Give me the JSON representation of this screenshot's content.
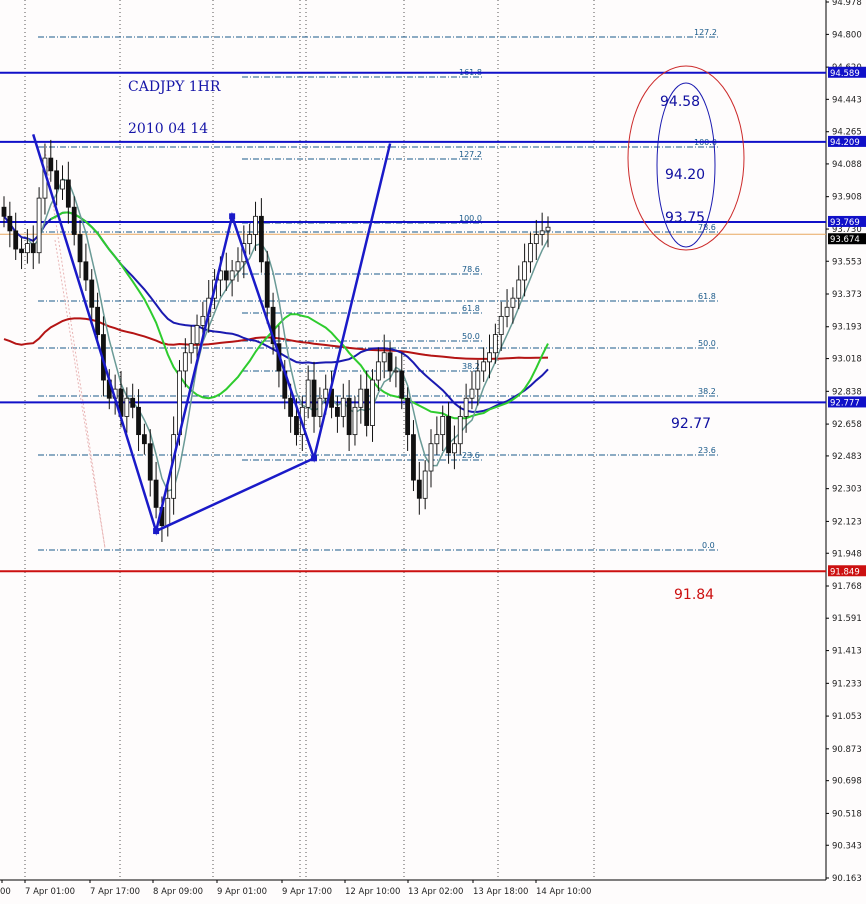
{
  "chart_data": {
    "type": "candlestick",
    "title_lines": [
      "CADJPY 1HR",
      "2010 04 14"
    ],
    "symbol": "CADJPY",
    "timeframe": "1HR",
    "date": "2010 04 14",
    "ylim": [
      90.163,
      94.978
    ],
    "y_ticks": [
      "94.978",
      "94.800",
      "94.620",
      "94.443",
      "94.265",
      "94.088",
      "93.908",
      "93.730",
      "93.553",
      "93.373",
      "93.193",
      "93.018",
      "92.838",
      "92.658",
      "92.483",
      "92.303",
      "92.123",
      "91.948",
      "91.768",
      "91.591",
      "91.413",
      "91.233",
      "91.053",
      "90.873",
      "90.698",
      "90.518",
      "90.343",
      "90.163"
    ],
    "x_ticks": [
      "00",
      "7 Apr 01:00",
      "7 Apr 17:00",
      "8 Apr 09:00",
      "9 Apr 01:00",
      "9 Apr 17:00",
      "12 Apr 10:00",
      "13 Apr 02:00",
      "13 Apr 18:00",
      "14 Apr 10:00"
    ],
    "horizontal_lines": [
      {
        "price": 94.589,
        "label": "94.589",
        "color": "#1010c8"
      },
      {
        "price": 94.209,
        "label": "94.209",
        "color": "#1010c8"
      },
      {
        "price": 93.769,
        "label": "93.769",
        "color": "#1010c8"
      },
      {
        "price": 92.777,
        "label": "92.777",
        "color": "#1010c8"
      },
      {
        "price": 91.849,
        "label": "91.849",
        "color": "#cc1010"
      }
    ],
    "current_price": {
      "price": 93.674,
      "label": "93.674"
    },
    "annotations": [
      {
        "text": "94.58",
        "color": "#1010a0"
      },
      {
        "text": "94.20",
        "color": "#1010a0"
      },
      {
        "text": "93.75",
        "color": "#1010a0"
      },
      {
        "text": "92.77",
        "color": "#1010a0"
      },
      {
        "text": "91.84",
        "color": "#cc1010"
      }
    ],
    "fib_upper_labels": [
      "127.2",
      "161.8",
      "100.0",
      "127.2",
      "100.0",
      "78.6",
      "61.8",
      "50.0",
      "38.2",
      "23.6"
    ],
    "fib_lower_labels": [
      "78.6",
      "61.8",
      "50.0",
      "38.2",
      "23.6",
      "0.0"
    ],
    "closes": [
      93.8,
      93.72,
      93.62,
      93.6,
      93.65,
      93.6,
      93.9,
      94.12,
      94.05,
      93.95,
      94.0,
      93.85,
      93.7,
      93.55,
      93.45,
      93.3,
      93.15,
      92.9,
      92.8,
      92.85,
      92.7,
      92.8,
      92.75,
      92.6,
      92.55,
      92.35,
      92.2,
      92.1,
      92.25,
      92.6,
      92.95,
      93.05,
      93.1,
      93.2,
      93.25,
      93.35,
      93.45,
      93.5,
      93.45,
      93.5,
      93.55,
      93.65,
      93.7,
      93.8,
      93.55,
      93.3,
      93.1,
      92.95,
      92.8,
      92.7,
      92.6,
      92.75,
      92.9,
      92.7,
      92.8,
      92.85,
      92.75,
      92.7,
      92.8,
      92.6,
      92.75,
      92.85,
      92.65,
      92.9,
      93.0,
      93.05,
      92.95,
      92.95,
      92.8,
      92.6,
      92.35,
      92.25,
      92.4,
      92.55,
      92.6,
      92.7,
      92.5,
      92.55,
      92.7,
      92.8,
      92.85,
      92.95,
      93.0,
      93.05,
      93.15,
      93.25,
      93.3,
      93.35,
      93.45,
      93.55,
      93.65,
      93.7,
      93.72,
      93.74
    ],
    "moving_averages": [
      {
        "name": "ma-gray",
        "color": "#6a9a96",
        "period": 5
      },
      {
        "name": "ma-green",
        "color": "#2ecc2e",
        "period": 21
      },
      {
        "name": "ma-blue",
        "color": "#1a1ab0",
        "period": 34
      },
      {
        "name": "ma-red",
        "color": "#b41414",
        "period": 89
      }
    ],
    "pattern_points": [
      {
        "x_index": 5,
        "price": 94.25
      },
      {
        "x_index": 26,
        "price": 92.07
      },
      {
        "x_index": 39,
        "price": 93.8
      },
      {
        "x_index": 53,
        "price": 92.47
      },
      {
        "x_index": 66,
        "price": 94.2
      }
    ]
  }
}
